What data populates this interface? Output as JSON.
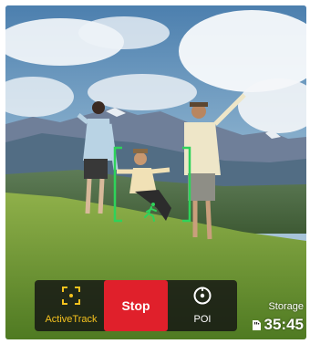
{
  "controls": {
    "activetrack_label": "ActiveTrack",
    "stop_label": "Stop",
    "poi_label": "POI"
  },
  "storage": {
    "label": "Storage",
    "time_remaining": "35:45"
  },
  "colors": {
    "accent_yellow": "#f4c21e",
    "stop_red": "#e0202b",
    "tracking_green": "#2ed35a"
  },
  "icons": {
    "activetrack": "activetrack-icon",
    "poi": "poi-icon",
    "storage_card": "sd-card-icon",
    "tracked_subject": "running-person-icon"
  }
}
